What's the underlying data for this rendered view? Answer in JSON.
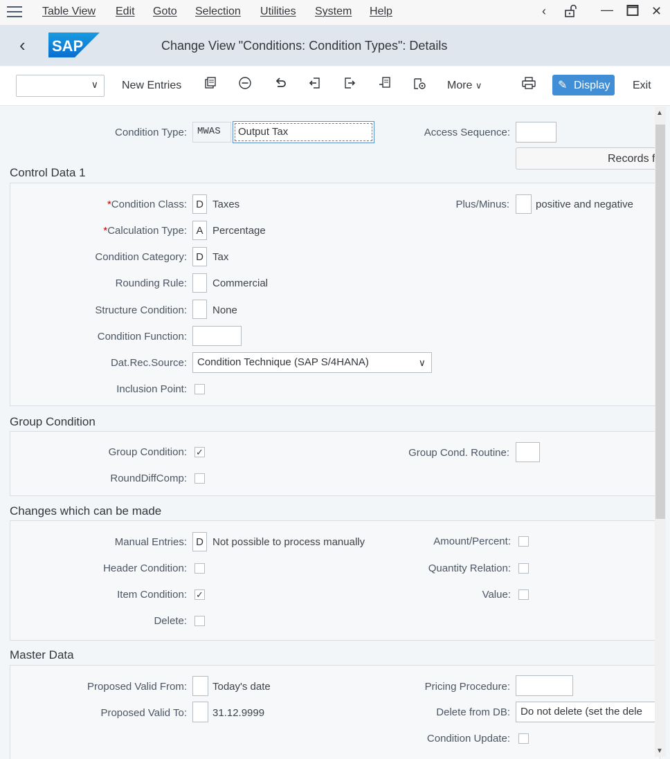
{
  "menu": {
    "items": [
      "Table View",
      "Edit",
      "Goto",
      "Selection",
      "Utilities",
      "System",
      "Help"
    ]
  },
  "header": {
    "logo_text": "SAP",
    "title": "Change View \"Conditions: Condition Types\": Details"
  },
  "toolbar": {
    "new_entries": "New Entries",
    "more": "More",
    "display": "Display",
    "exit": "Exit"
  },
  "top": {
    "condition_type_label": "Condition Type:",
    "condition_type_code": "MWAS",
    "condition_type_name": "Output Tax",
    "access_sequence_label": "Access Sequence:",
    "records_button": "Records f"
  },
  "control_data_1": {
    "title": "Control Data 1",
    "condition_class": {
      "label": "Condition Class:",
      "value": "D",
      "desc": "Taxes"
    },
    "calculation_type": {
      "label": "Calculation Type:",
      "value": "A",
      "desc": "Percentage"
    },
    "condition_category": {
      "label": "Condition Category:",
      "value": "D",
      "desc": "Tax"
    },
    "rounding_rule": {
      "label": "Rounding Rule:",
      "value": "",
      "desc": "Commercial"
    },
    "structure_condition": {
      "label": "Structure Condition:",
      "value": "",
      "desc": "None"
    },
    "condition_function": {
      "label": "Condition Function:",
      "value": ""
    },
    "dat_rec_source": {
      "label": "Dat.Rec.Source:",
      "value": "Condition Technique (SAP S/4HANA)"
    },
    "inclusion_point": {
      "label": "Inclusion Point:",
      "checked": false
    },
    "plus_minus": {
      "label": "Plus/Minus:",
      "value": "",
      "desc": "positive and negative"
    }
  },
  "group_condition": {
    "title": "Group Condition",
    "group_condition": {
      "label": "Group Condition:",
      "checked": true
    },
    "round_diff_comp": {
      "label": "RoundDiffComp:",
      "checked": false
    },
    "group_cond_routine": {
      "label": "Group Cond. Routine:",
      "value": ""
    }
  },
  "changes": {
    "title": "Changes which can be made",
    "manual_entries": {
      "label": "Manual Entries:",
      "value": "D",
      "desc": "Not possible to process manually"
    },
    "header_condition": {
      "label": "Header Condition:",
      "checked": false
    },
    "item_condition": {
      "label": "Item Condition:",
      "checked": true
    },
    "delete": {
      "label": "Delete:",
      "checked": false
    },
    "amount_percent": {
      "label": "Amount/Percent:",
      "checked": false
    },
    "quantity_relation": {
      "label": "Quantity Relation:",
      "checked": false
    },
    "value": {
      "label": "Value:",
      "checked": false
    }
  },
  "master_data": {
    "title": "Master Data",
    "proposed_valid_from": {
      "label": "Proposed Valid From:",
      "value": "",
      "desc": "Today's date"
    },
    "proposed_valid_to": {
      "label": "Proposed Valid To:",
      "value": "",
      "desc": "31.12.9999"
    },
    "pricing_procedure": {
      "label": "Pricing Procedure:",
      "value": ""
    },
    "delete_from_db": {
      "label": "Delete from DB:",
      "value": "Do not delete (set the dele"
    },
    "condition_update": {
      "label": "Condition Update:",
      "checked": false
    }
  },
  "colors": {
    "accent": "#3f8ed6",
    "sap_blue": "#0a6ed1",
    "title_bar": "#dfe6ee",
    "required": "#bb0000"
  }
}
